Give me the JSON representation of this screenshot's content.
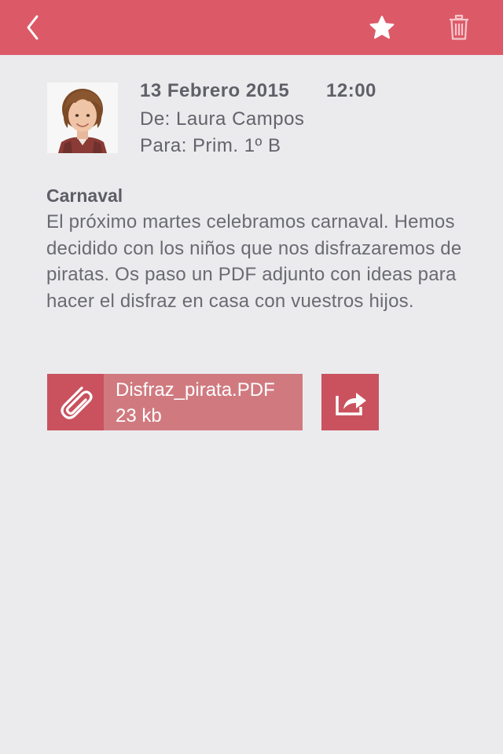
{
  "header": {
    "background_color": "#dc5a68",
    "back_icon": "chevron-left-icon",
    "favorite_icon": "star-icon",
    "delete_icon": "trash-icon"
  },
  "message": {
    "avatar_icon": "child-avatar",
    "date": "13 Febrero 2015",
    "time": "12:00",
    "from": "De: Laura Campos",
    "to": "Para: Prim. 1º B",
    "subject": "Carnaval",
    "body": "El próximo martes celebramos carnaval. Hemos decidido con los niños que nos disfrazaremos de piratas. Os paso un PDF adjunto con ideas para hacer el disfraz en casa con vuestros hijos."
  },
  "attachment": {
    "file_name": "Disfraz_pirata.PDF",
    "file_size": "23 kb",
    "clip_icon": "paperclip-icon",
    "share_icon": "share-icon",
    "accent_color": "#c9525e"
  }
}
